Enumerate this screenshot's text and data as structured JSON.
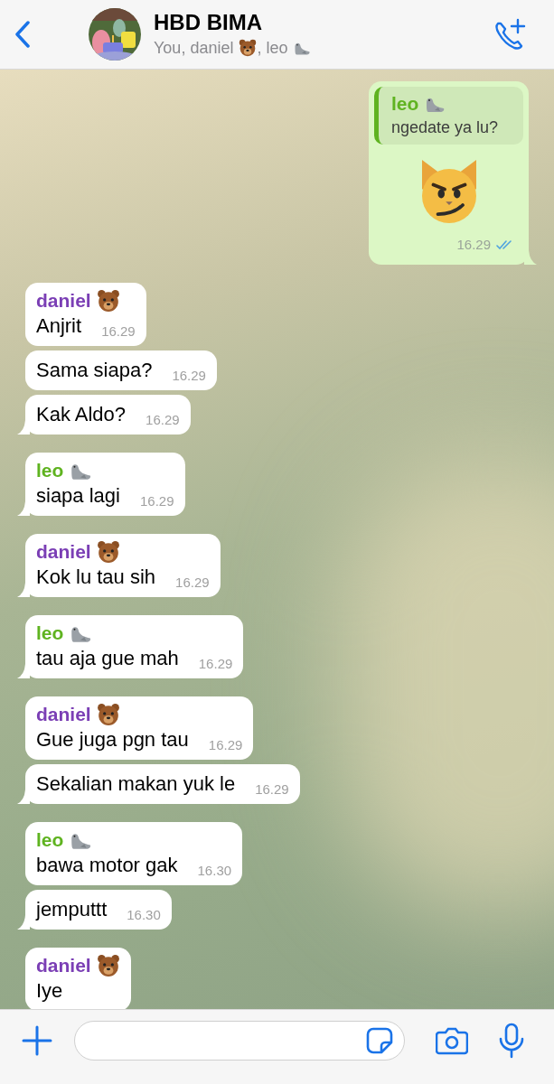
{
  "header": {
    "title": "HBD BIMA",
    "subtitle": [
      {
        "kind": "text",
        "text": "You, daniel"
      },
      {
        "kind": "bear"
      },
      {
        "kind": "text",
        "text": ", leo"
      },
      {
        "kind": "seal"
      }
    ]
  },
  "messages": [
    {
      "kind": "outgoing_sticker",
      "quote": {
        "sender": {
          "name": "leo",
          "kind": "seal",
          "color": "#5fb320"
        },
        "text": "ngedate ya lu?"
      },
      "time": "16.29",
      "read": true,
      "tail": true
    },
    {
      "kind": "incoming",
      "sender": {
        "name": "daniel",
        "kind": "bear",
        "color": "#7b3fb5"
      },
      "text": "Anjrit",
      "time": "16.29",
      "tail": false
    },
    {
      "kind": "incoming",
      "text": "Sama siapa?",
      "time": "16.29",
      "tail": false
    },
    {
      "kind": "incoming",
      "text": "Kak Aldo?",
      "time": "16.29",
      "tail": true
    },
    {
      "kind": "incoming",
      "sender": {
        "name": "leo",
        "kind": "seal",
        "color": "#5fb320"
      },
      "text": "siapa lagi",
      "time": "16.29",
      "tail": true
    },
    {
      "kind": "incoming",
      "sender": {
        "name": "daniel",
        "kind": "bear",
        "color": "#7b3fb5"
      },
      "text": "Kok lu tau sih",
      "time": "16.29",
      "tail": true
    },
    {
      "kind": "incoming",
      "sender": {
        "name": "leo",
        "kind": "seal",
        "color": "#5fb320"
      },
      "text": "tau aja gue mah",
      "time": "16.29",
      "tail": true
    },
    {
      "kind": "incoming",
      "sender": {
        "name": "daniel",
        "kind": "bear",
        "color": "#7b3fb5"
      },
      "text": "Gue juga pgn tau",
      "time": "16.29",
      "tail": false
    },
    {
      "kind": "incoming",
      "text": "Sekalian makan yuk le",
      "time": "16.29",
      "tail": true
    },
    {
      "kind": "incoming",
      "sender": {
        "name": "leo",
        "kind": "seal",
        "color": "#5fb320"
      },
      "text": "bawa motor gak",
      "time": "16.30",
      "tail": false
    },
    {
      "kind": "incoming",
      "text": "jemputtt",
      "time": "16.30",
      "tail": true
    },
    {
      "kind": "incoming",
      "sender": {
        "name": "daniel",
        "kind": "bear",
        "color": "#7b3fb5"
      },
      "text": "Iye"
    }
  ]
}
